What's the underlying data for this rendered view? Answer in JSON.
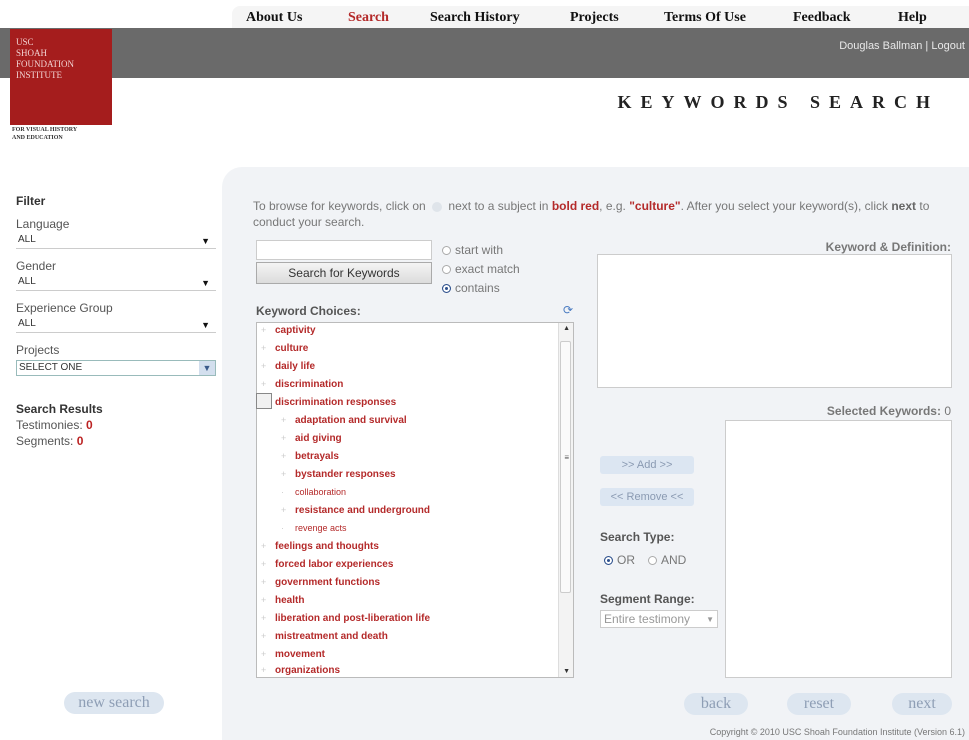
{
  "nav": {
    "items": [
      "About Us",
      "Search",
      "Search History",
      "Projects",
      "Terms Of Use",
      "Feedback",
      "Help"
    ],
    "active": "Search"
  },
  "user": {
    "name": "Douglas Ballman",
    "logout": "Logout",
    "sep": "|"
  },
  "logo": {
    "lines": [
      "USC",
      "SHOAH",
      "FOUNDATION",
      "INSTITUTE"
    ],
    "tagline": [
      "FOR VISUAL HISTORY",
      "AND EDUCATION"
    ]
  },
  "page_title": "KEYWORDS SEARCH",
  "filter": {
    "heading": "Filter",
    "language_label": "Language",
    "language_value": "ALL",
    "gender_label": "Gender",
    "gender_value": "ALL",
    "experience_label": "Experience Group",
    "experience_value": "ALL",
    "projects_label": "Projects",
    "projects_value": "SELECT ONE"
  },
  "results": {
    "heading": "Search Results",
    "testimonies_label": "Testimonies:",
    "testimonies_value": "0",
    "segments_label": "Segments:",
    "segments_value": "0"
  },
  "buttons": {
    "new_search": "new search",
    "back": "back",
    "reset": "reset",
    "next": "next"
  },
  "instructions": {
    "p1": "To browse for keywords, click on",
    "p2": "next to a subject in",
    "bold_red": "bold red",
    "p3": ", e.g.",
    "example": "\"culture\"",
    "p4": ". After you select your keyword(s), click",
    "next_word": "next",
    "p5": "to conduct your search."
  },
  "search": {
    "input_value": "",
    "button": "Search for Keywords",
    "modes": [
      {
        "label": "start with",
        "selected": false
      },
      {
        "label": "exact match",
        "selected": false
      },
      {
        "label": "contains",
        "selected": true
      }
    ]
  },
  "keywords": {
    "title": "Keyword Choices:",
    "items": [
      {
        "label": "captivity"
      },
      {
        "label": "culture"
      },
      {
        "label": "daily life"
      },
      {
        "label": "discrimination"
      },
      {
        "label": "discrimination responses"
      },
      {
        "label": "adaptation and survival"
      },
      {
        "label": "aid giving"
      },
      {
        "label": "betrayals"
      },
      {
        "label": "bystander responses"
      },
      {
        "label": "collaboration"
      },
      {
        "label": "resistance and underground"
      },
      {
        "label": "revenge acts"
      },
      {
        "label": "feelings and thoughts"
      },
      {
        "label": "forced labor experiences"
      },
      {
        "label": "government functions"
      },
      {
        "label": "health"
      },
      {
        "label": "liberation and post-liberation life"
      },
      {
        "label": "mistreatment and death"
      },
      {
        "label": "movement"
      },
      {
        "label": "organizations"
      }
    ]
  },
  "definition": {
    "label": "Keyword & Definition:"
  },
  "selected": {
    "label": "Selected Keywords:",
    "count": "0"
  },
  "actions": {
    "add": ">> Add >>",
    "remove": "<< Remove <<"
  },
  "search_type": {
    "label": "Search Type:",
    "options": [
      {
        "label": "OR",
        "selected": true
      },
      {
        "label": "AND",
        "selected": false
      }
    ]
  },
  "segment_range": {
    "label": "Segment Range:",
    "value": "Entire testimony"
  },
  "footer": "Copyright © 2010 USC Shoah Foundation Institute (Version 6.1)",
  "colors": {
    "accent_red": "#b42a2a",
    "header_gray": "#6a6a6a",
    "panel_bg": "#f1f3f6",
    "logo_red": "#a51d1d"
  }
}
